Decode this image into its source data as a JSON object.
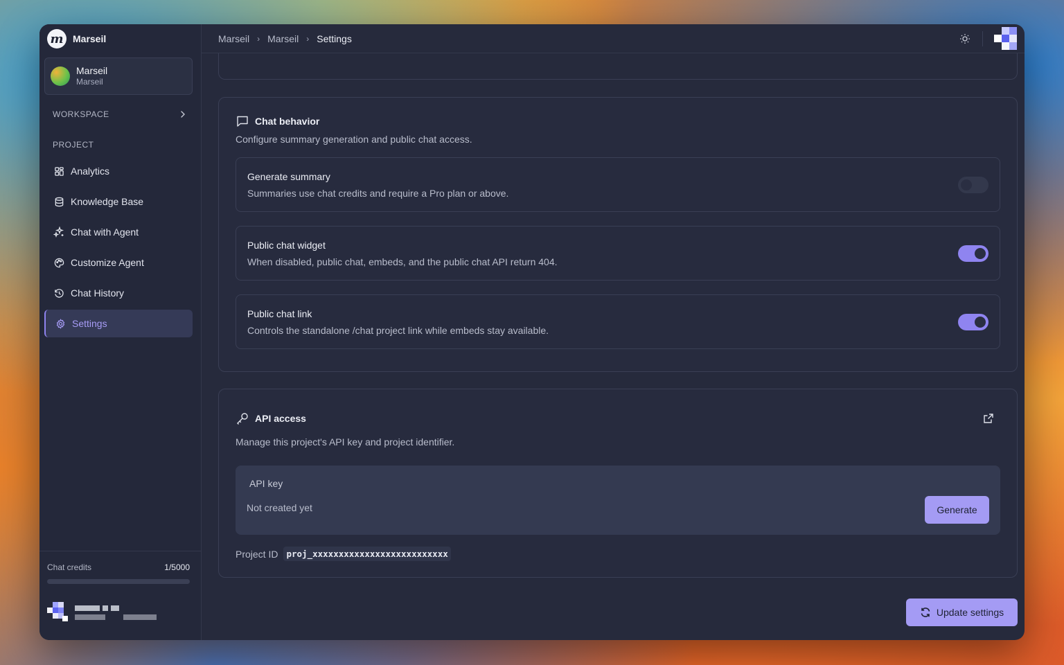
{
  "app": {
    "name": "Marseil",
    "logo_letter": "m"
  },
  "project_switcher": {
    "title": "Marseil",
    "subtitle": "Marseil"
  },
  "sidebar": {
    "workspace_label": "WORKSPACE",
    "project_label": "PROJECT",
    "items": [
      {
        "label": "Analytics",
        "icon": "analytics-icon"
      },
      {
        "label": "Knowledge Base",
        "icon": "database-icon"
      },
      {
        "label": "Chat with Agent",
        "icon": "sparkles-icon"
      },
      {
        "label": "Customize Agent",
        "icon": "palette-icon"
      },
      {
        "label": "Chat History",
        "icon": "history-icon"
      },
      {
        "label": "Settings",
        "icon": "gear-icon",
        "active": true
      }
    ],
    "credits_label": "Chat credits",
    "credits_value": "1/5000",
    "credits_fraction": 0.0002
  },
  "breadcrumb": [
    "Marseil",
    "Marseil",
    "Settings"
  ],
  "chat_behavior": {
    "title": "Chat behavior",
    "description": "Configure summary generation and public chat access.",
    "settings": [
      {
        "title": "Generate summary",
        "description": "Summaries use chat credits and require a Pro plan or above.",
        "enabled": false
      },
      {
        "title": "Public chat widget",
        "description": "When disabled, public chat, embeds, and the public chat API return 404.",
        "enabled": true
      },
      {
        "title": "Public chat link",
        "description": "Controls the standalone /chat project link while embeds stay available.",
        "enabled": true
      }
    ]
  },
  "api_access": {
    "title": "API access",
    "description": "Manage this project's API key and project identifier.",
    "key_label": "API key",
    "key_value": "Not created yet",
    "generate_label": "Generate",
    "project_id_label": "Project ID",
    "project_id_value": "proj_xxxxxxxxxxxxxxxxxxxxxxxxxx"
  },
  "update_label": "Update settings",
  "colors": {
    "accent": "#8f84f0",
    "button": "#a49bf4",
    "panel": "#262a3c",
    "sidebar": "#24283a"
  }
}
